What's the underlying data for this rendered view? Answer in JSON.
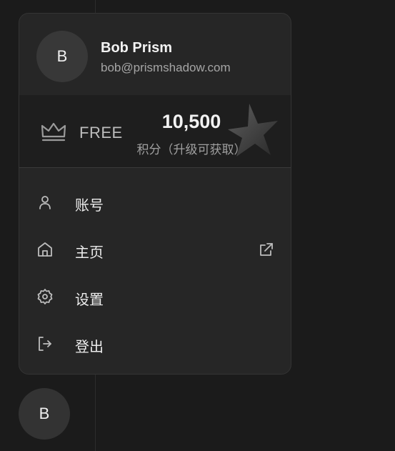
{
  "user": {
    "initial": "B",
    "name": "Bob Prism",
    "email": "bob@prismshadow.com"
  },
  "plan": {
    "icon": "crown-icon",
    "name": "FREE",
    "credits": "10,500",
    "credits_label": "积分（升级可获取）"
  },
  "menu": {
    "items": [
      {
        "label": "账号",
        "icon": "user-icon"
      },
      {
        "label": "主页",
        "icon": "home-icon",
        "trailing_icon": "external-link-icon"
      },
      {
        "label": "设置",
        "icon": "gear-icon"
      },
      {
        "label": "登出",
        "icon": "logout-icon"
      }
    ]
  },
  "sidebar": {
    "avatar_initial": "B"
  }
}
